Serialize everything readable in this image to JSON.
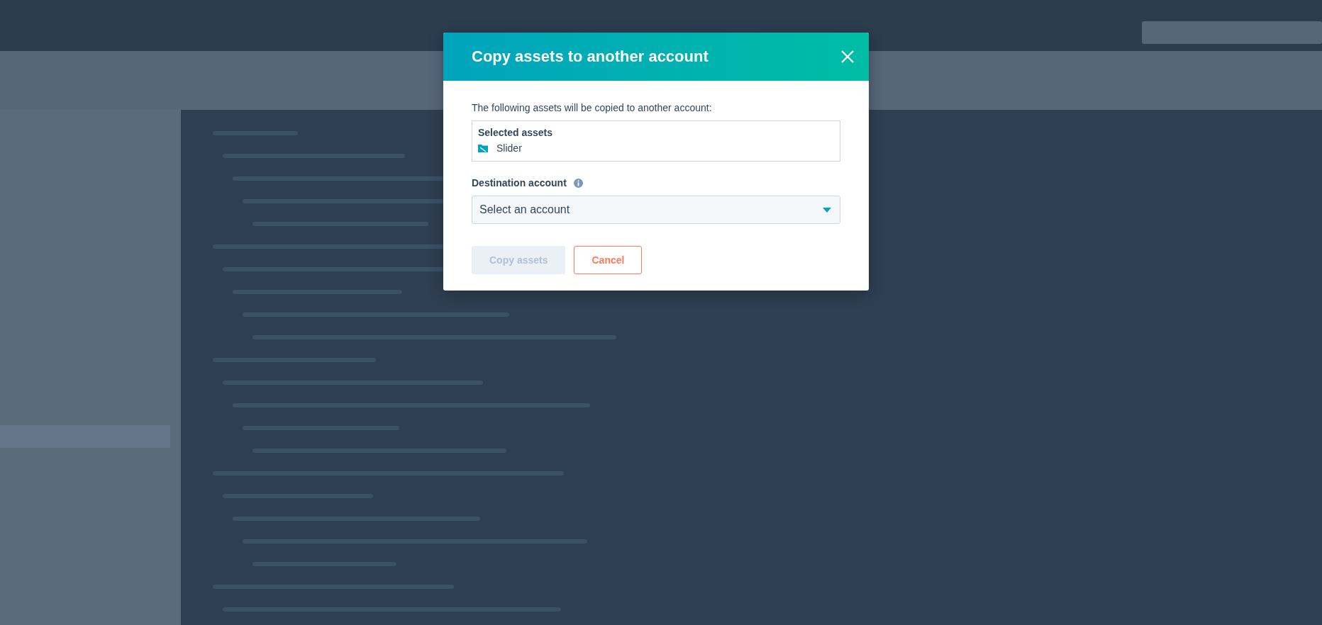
{
  "dialog": {
    "title": "Copy assets to another account",
    "intro": "The following assets will be copied to another account:",
    "selected_assets": {
      "heading": "Selected assets",
      "items": [
        {
          "name": "Slider"
        }
      ]
    },
    "destination": {
      "label": "Destination account",
      "placeholder": "Select an account"
    },
    "buttons": [
      {
        "label": "Copy assets",
        "kind": "primary",
        "disabled": true
      },
      {
        "label": "Cancel",
        "kind": "secondary",
        "disabled": false
      }
    ]
  }
}
